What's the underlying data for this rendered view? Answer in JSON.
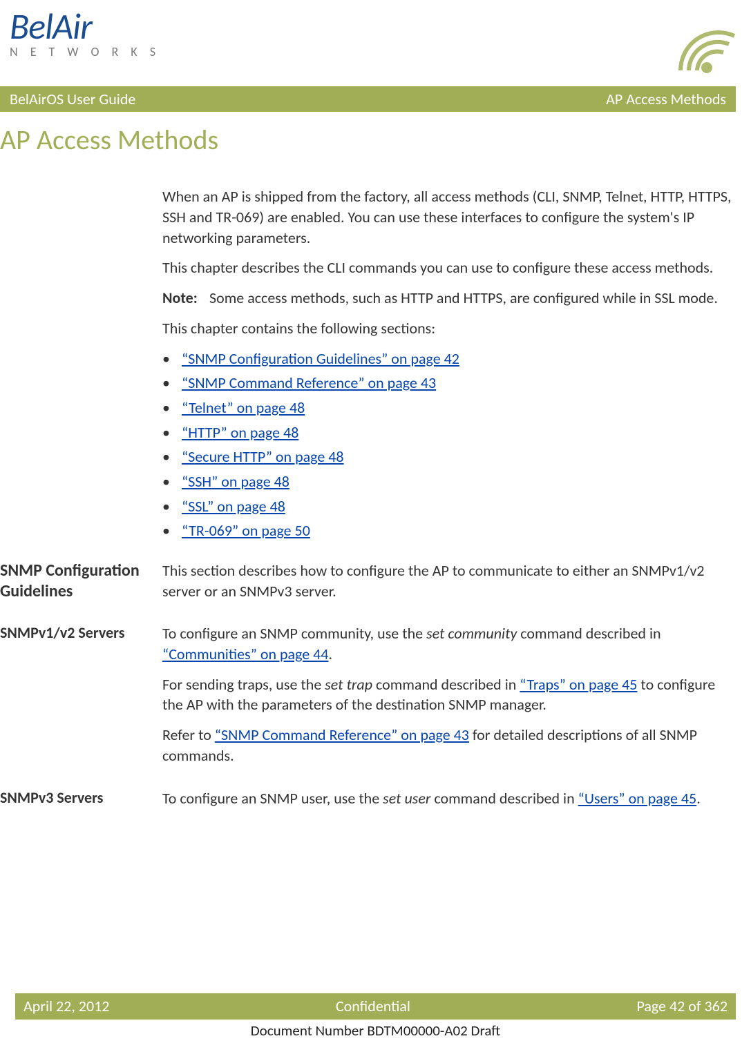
{
  "logo": {
    "top": "BelAir",
    "bottom": "N E T W O R K S"
  },
  "titlebar": {
    "left": "BelAirOS User Guide",
    "right": "AP Access Methods"
  },
  "page_title": "AP Access Methods",
  "intro": {
    "p1": "When an AP is shipped from the factory, all access methods (CLI, SNMP, Telnet, HTTP, HTTPS, SSH and TR-069) are enabled. You can use these interfaces to configure the system's IP networking parameters.",
    "p2": "This chapter describes the CLI commands you can use to configure these access methods.",
    "note_label": "Note:",
    "note_text": "Some access methods, such as HTTP and HTTPS, are configured while in SSL mode.",
    "p3": "This chapter contains the following sections:",
    "links": [
      "“SNMP Configuration Guidelines” on page 42",
      "“SNMP Command Reference” on page 43",
      "“Telnet” on page 48",
      "“HTTP” on page 48",
      "“Secure HTTP” on page 48",
      "“SSH” on page 48",
      "“SSL” on page 48",
      "“TR-069” on page 50"
    ]
  },
  "sec1": {
    "heading": "SNMP Configuration Guidelines",
    "body": "This section describes how to configure the AP to communicate to either an SNMPv1/v2 server or an SNMPv3 server."
  },
  "sec2": {
    "heading": "SNMPv1/v2 Servers",
    "p1a": "To configure an SNMP community, use the ",
    "p1_cmd": "set community",
    "p1b": " command described in ",
    "p1_link": "“Communities” on page 44",
    "p1c": ".",
    "p2a": "For sending traps, use the ",
    "p2_cmd": "set trap",
    "p2b": " command described in ",
    "p2_link": "“Traps” on page 45",
    "p2c": " to configure the AP with the parameters of the destination SNMP manager.",
    "p3a": "Refer to ",
    "p3_link": "“SNMP Command Reference” on page 43",
    "p3b": " for detailed descriptions of all SNMP commands."
  },
  "sec3": {
    "heading": "SNMPv3 Servers",
    "p1a": "To configure an SNMP user, use the ",
    "p1_cmd": "set user",
    "p1b": " command described in ",
    "p1_link": "“Users” on page 45",
    "p1c": "."
  },
  "footer": {
    "date": "April 22, 2012",
    "conf": "Confidential",
    "page": "Page 42 of 362",
    "docnum": "Document Number BDTM00000-A02 Draft"
  }
}
